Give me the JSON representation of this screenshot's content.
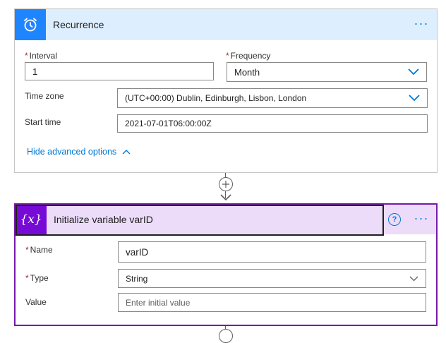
{
  "recurrence": {
    "title": "Recurrence",
    "more_label": "···",
    "icon": "alarm-clock-icon",
    "interval": {
      "label": "Interval",
      "value": "1"
    },
    "frequency": {
      "label": "Frequency",
      "value": "Month"
    },
    "time_zone": {
      "label": "Time zone",
      "value": "(UTC+00:00) Dublin, Edinburgh, Lisbon, London"
    },
    "start_time": {
      "label": "Start time",
      "value": "2021-07-01T06:00:00Z"
    },
    "advanced_link": "Hide advanced options"
  },
  "connector": {
    "icon": "plus-icon"
  },
  "variable": {
    "title": "Initialize variable varID",
    "icon_text": "{x}",
    "help_label": "?",
    "more_label": "···",
    "name": {
      "label": "Name",
      "value": "varID"
    },
    "type": {
      "label": "Type",
      "value": "String"
    },
    "value": {
      "label": "Value",
      "placeholder": "Enter initial value"
    }
  },
  "colors": {
    "recurrence_accent": "#1f85ff",
    "recurrence_header": "#ddeeff",
    "variable_accent": "#770bd6",
    "variable_header": "#ecdcfa",
    "link": "#0078d4",
    "required": "#a4262c"
  }
}
